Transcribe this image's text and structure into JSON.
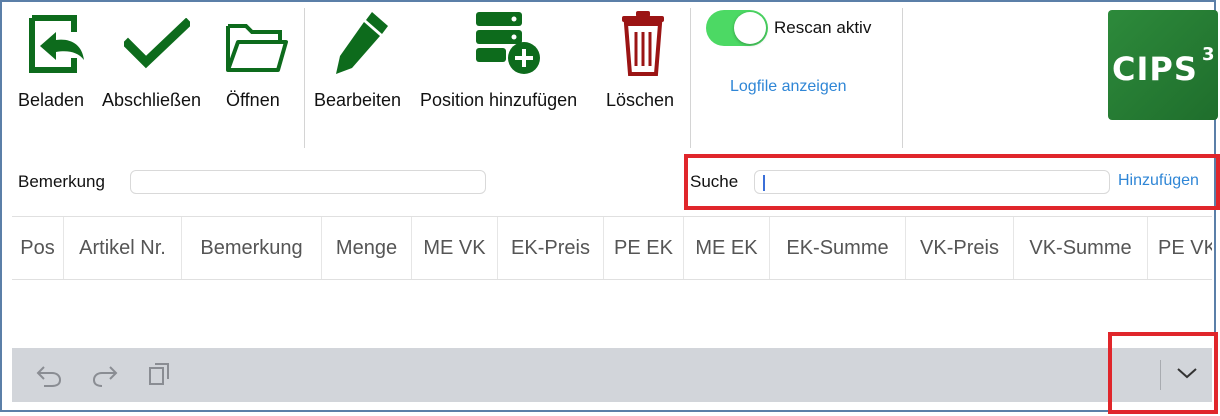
{
  "toolbar": {
    "beladen": "Beladen",
    "abschliessen": "Abschließen",
    "oeffnen": "Öffnen",
    "bearbeiten": "Bearbeiten",
    "position_hinzufuegen": "Position hinzufügen",
    "loeschen": "Löschen"
  },
  "rescan": {
    "label": "Rescan aktiv",
    "enabled": true
  },
  "logfile_link": "Logfile anzeigen",
  "logo": {
    "text": "CIPS",
    "superscript": "3"
  },
  "remark": {
    "label": "Bemerkung",
    "value": ""
  },
  "search": {
    "label": "Suche",
    "value": "",
    "add_link": "Hinzufügen"
  },
  "table": {
    "columns": [
      "Pos",
      "Artikel Nr.",
      "Bemerkung",
      "Menge",
      "ME VK",
      "EK-Preis",
      "PE EK",
      "ME EK",
      "EK-Summe",
      "VK-Preis",
      "VK-Summe",
      "PE VK"
    ]
  },
  "icons": {
    "undo": "undo-icon",
    "redo": "redo-icon",
    "paste": "paste-icon",
    "chevron": "chevron-down-icon"
  },
  "colors": {
    "toolbar_icon_green": "#0d6b1c",
    "delete_icon_red": "#9b1414",
    "link_blue": "#2f86d6",
    "toggle_green": "#4cd964",
    "highlight_red": "#e0262b",
    "bottom_bar": "#d2d5da"
  }
}
